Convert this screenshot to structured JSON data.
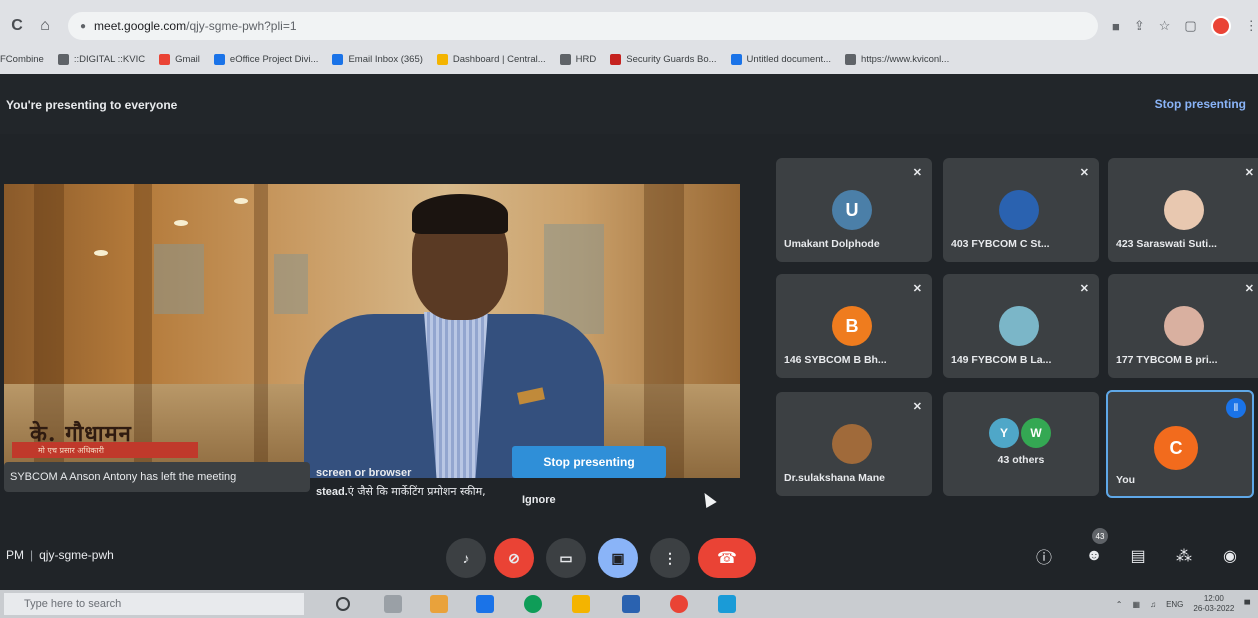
{
  "browser": {
    "url_host": "meet.google.com",
    "url_path": "/qjy-sgme-pwh?pli=1",
    "bookmarks": [
      {
        "label": "FCombine",
        "icon": "",
        "color": ""
      },
      {
        "label": "::DIGITAL ::KVIC",
        "icon": "globe-icon",
        "color": "#5f6368"
      },
      {
        "label": "Gmail",
        "icon": "gmail-icon",
        "color": "#ea4335"
      },
      {
        "label": "eOffice Project Divi...",
        "icon": "search-icon",
        "color": "#1a73e8"
      },
      {
        "label": "Email Inbox (365)",
        "icon": "mail-icon",
        "color": "#1a73e8"
      },
      {
        "label": "Dashboard | Central...",
        "icon": "dashboard-icon",
        "color": "#f4b400"
      },
      {
        "label": "HRD",
        "icon": "globe-icon",
        "color": "#5f6368"
      },
      {
        "label": "Security Guards Bo...",
        "icon": "shield-icon",
        "color": "#c5221f"
      },
      {
        "label": "Untitled document...",
        "icon": "doc-icon",
        "color": "#1a73e8"
      },
      {
        "label": "https://www.kviconl...",
        "icon": "globe-icon",
        "color": "#5f6368"
      }
    ]
  },
  "meet": {
    "presenting_banner": "You're presenting to everyone",
    "stop_presenting_top": "Stop presenting",
    "main_video": {
      "hindi_name": "के. गौधामन",
      "hindi_subtitle": "मो एच प्रसार अधिकारी"
    },
    "toast": "SYBCOM A Anson Antony has left the meeting",
    "notice_line1": "screen or browser",
    "notice_line2_prefix": "stead.",
    "notice_line2_hindi": "एं जैसे कि मार्केटिंग प्रमोशन स्कीम,",
    "stop_presenting_button": "Stop presenting",
    "ignore_button": "Ignore",
    "participants": [
      {
        "name": "Umakant Dolphode",
        "initial": "U",
        "color": "#4b7fa8",
        "kind": "initial"
      },
      {
        "name": "403 FYBCOM C St...",
        "initial": "",
        "color": "#2a62b0",
        "kind": "photo"
      },
      {
        "name": "423 Saraswati Suti...",
        "initial": "",
        "color": "#e8c8b0",
        "kind": "photo"
      },
      {
        "name": "146 SYBCOM B Bh...",
        "initial": "B",
        "color": "#ef7c1e",
        "kind": "initial"
      },
      {
        "name": "149 FYBCOM B La...",
        "initial": "",
        "color": "#7bb6c8",
        "kind": "photo"
      },
      {
        "name": "177 TYBCOM B pri...",
        "initial": "",
        "color": "#d9b0a0",
        "kind": "photo"
      },
      {
        "name": "Dr.sulakshana Mane",
        "initial": "",
        "color": "#a06a3a",
        "kind": "photo"
      },
      {
        "name": "43 others",
        "initials": [
          "Y",
          "W"
        ],
        "colors": [
          "#4fa7c8",
          "#34a853"
        ],
        "kind": "group"
      },
      {
        "name": "You",
        "initial": "C",
        "color": "#f26b1d",
        "kind": "self"
      }
    ],
    "meeting_time": "PM",
    "meeting_code": "qjy-sgme-pwh",
    "people_count": "43",
    "controls": {
      "mic": "mic-icon",
      "camera": "camera-off-icon",
      "captions": "captions-icon",
      "present": "present-icon",
      "more": "more-icon",
      "hangup": "hangup-icon"
    }
  },
  "taskbar": {
    "search_placeholder": "Type here to search",
    "language": "ENG",
    "time": "12:00",
    "date": "26-03-2022"
  }
}
